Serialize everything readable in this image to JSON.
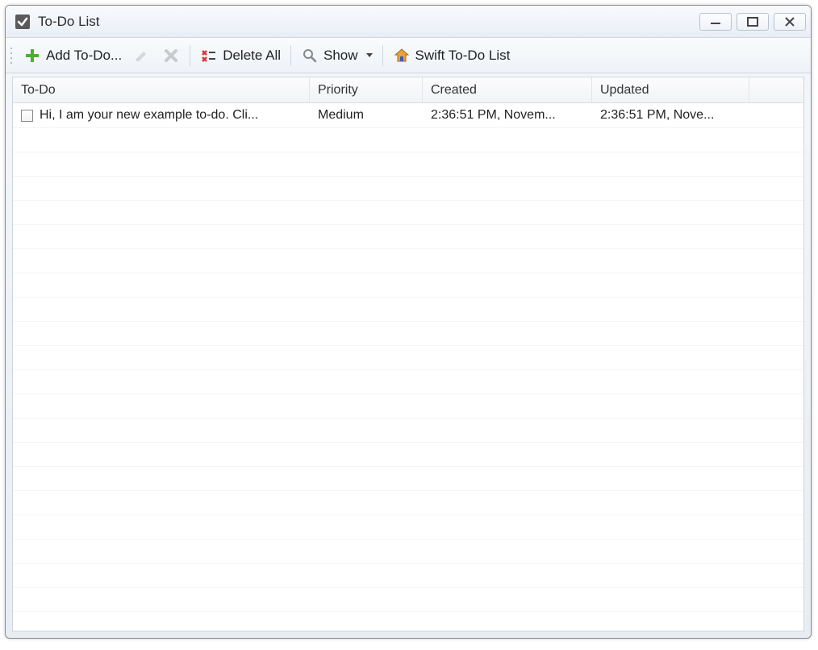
{
  "window": {
    "title": "To-Do List"
  },
  "toolbar": {
    "add_label": "Add To-Do...",
    "delete_all_label": "Delete All",
    "show_label": "Show",
    "swift_label": "Swift To-Do List"
  },
  "columns": {
    "todo": "To-Do",
    "priority": "Priority",
    "created": "Created",
    "updated": "Updated"
  },
  "rows": [
    {
      "checked": false,
      "todo": "Hi, I am your new example to-do. Cli...",
      "priority": "Medium",
      "created": "2:36:51 PM, Novem...",
      "updated": "2:36:51 PM, Nove..."
    }
  ]
}
